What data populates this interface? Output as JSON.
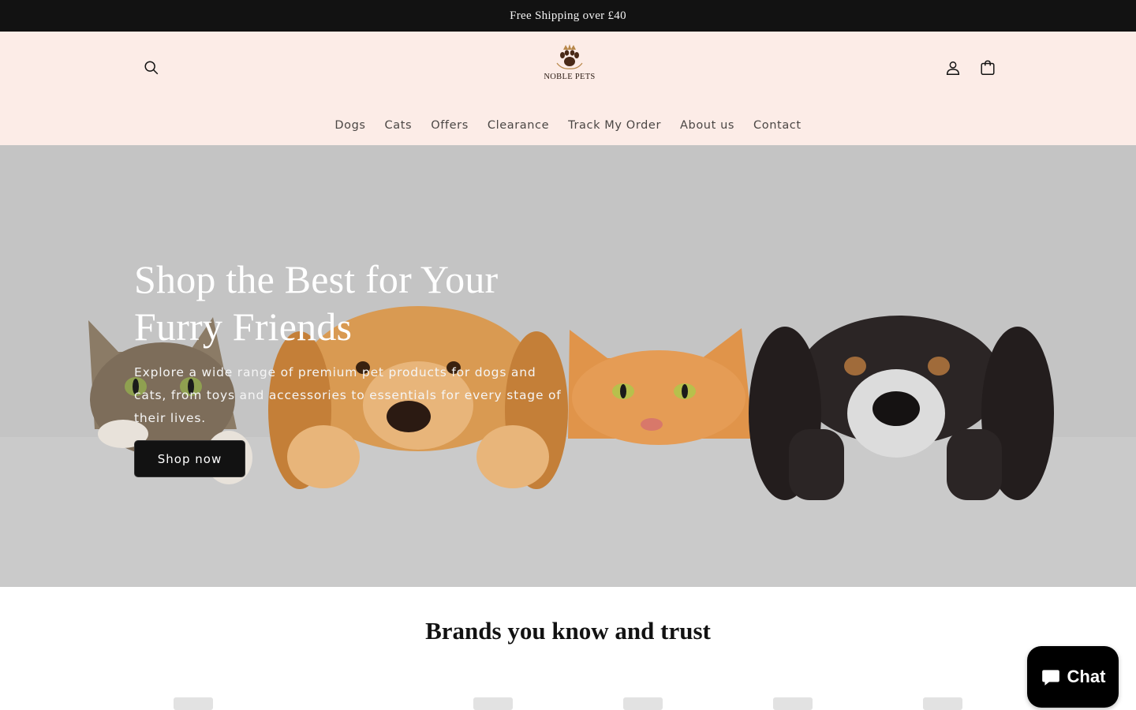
{
  "announcement": {
    "text": "Free Shipping over £40"
  },
  "header": {
    "logo_text": "NOBLE PETS",
    "search_icon": "search-icon",
    "account_icon": "account-icon",
    "cart_icon": "cart-icon"
  },
  "nav": {
    "items": [
      {
        "label": "Dogs"
      },
      {
        "label": "Cats"
      },
      {
        "label": "Offers"
      },
      {
        "label": "Clearance"
      },
      {
        "label": "Track My Order"
      },
      {
        "label": "About us"
      },
      {
        "label": "Contact"
      }
    ]
  },
  "hero": {
    "title_line1": "Shop the Best for Your",
    "title_line2": "Furry Friends",
    "subtitle": "Explore a wide range of premium pet products for dogs and cats, from toys and accessories to essentials for every stage of their lives.",
    "cta_label": "Shop now"
  },
  "brands": {
    "title": "Brands you know and trust"
  },
  "chat": {
    "label": "Chat",
    "icon": "chat-bubble-icon"
  },
  "colors": {
    "announcement_bg": "#121212",
    "header_bg": "#fcece7",
    "hero_bg": "#c3c3c3",
    "button_bg": "#121212"
  }
}
